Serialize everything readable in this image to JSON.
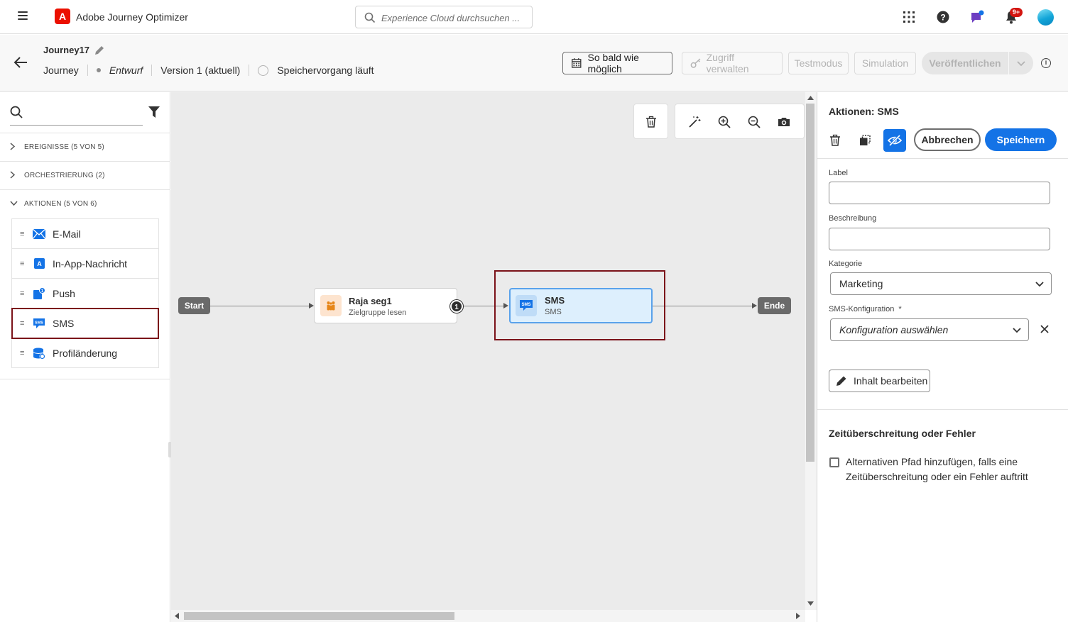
{
  "app": {
    "title": "Adobe Journey Optimizer",
    "logo_letter": "A",
    "search_placeholder": "Experience Cloud durchsuchen ...",
    "notification_count": "9+"
  },
  "journey": {
    "name": "Journey17",
    "type": "Journey",
    "status": "Entwurf",
    "version": "Version 1 (aktuell)",
    "save_status": "Speichervorgang läuft",
    "buttons": {
      "schedule": "So bald wie möglich",
      "manage_access": "Zugriff verwalten",
      "test_mode": "Testmodus",
      "simulation": "Simulation",
      "publish": "Veröffentlichen"
    }
  },
  "palette": {
    "sections": [
      {
        "label": "EREIGNISSE (5 VON 5)",
        "expanded": false
      },
      {
        "label": "ORCHESTRIERUNG (2)",
        "expanded": false
      },
      {
        "label": "AKTIONEN (5 VON 6)",
        "expanded": true
      }
    ],
    "actions": [
      {
        "label": "E-Mail",
        "icon": "email-icon",
        "color": "#1473e6"
      },
      {
        "label": "In-App-Nachricht",
        "icon": "in-app-icon",
        "color": "#1473e6"
      },
      {
        "label": "Push",
        "icon": "push-icon",
        "color": "#1473e6"
      },
      {
        "label": "SMS",
        "icon": "sms-icon",
        "color": "#1473e6"
      },
      {
        "label": "Profiländerung",
        "icon": "profile-update-icon",
        "color": "#1473e6"
      }
    ]
  },
  "canvas": {
    "start_label": "Start",
    "end_label": "Ende",
    "read_audience": {
      "title": "Raja seg1",
      "subtitle": "Zielgruppe lesen",
      "badge": "1"
    },
    "sms_node": {
      "title": "SMS",
      "subtitle": "SMS",
      "icon_text": "SMS"
    }
  },
  "properties": {
    "title": "Aktionen: SMS",
    "cancel": "Abbrechen",
    "save": "Speichern",
    "label_field": {
      "label": "Label",
      "value": ""
    },
    "description_field": {
      "label": "Beschreibung",
      "value": ""
    },
    "category": {
      "label": "Kategorie",
      "value": "Marketing"
    },
    "sms_config": {
      "label": "SMS-Konfiguration",
      "required": "*",
      "placeholder": "Konfiguration auswählen"
    },
    "edit_content": "Inhalt bearbeiten",
    "timeout_section": "Zeitüberschreitung oder Fehler",
    "timeout_checkbox": "Alternativen Pfad hinzufügen, falls eine Zeitüberschreitung oder ein Fehler auftritt"
  },
  "colors": {
    "accent": "#1473e6",
    "highlight": "#7b1219",
    "adobe_red": "#eb1000"
  }
}
